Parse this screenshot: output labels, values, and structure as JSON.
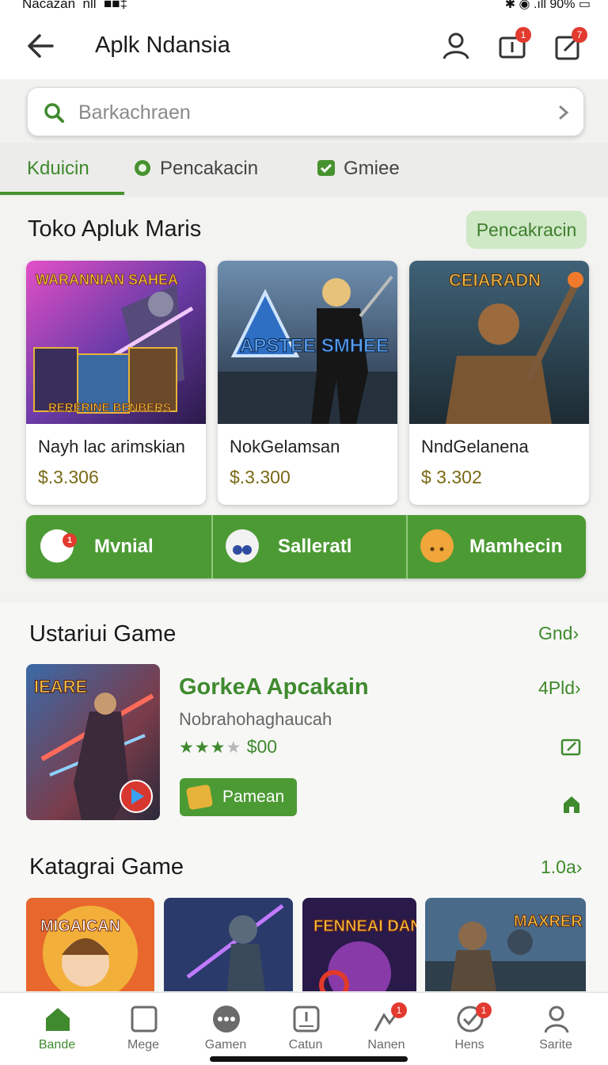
{
  "status_bar": {
    "left": "Nacazan  nll  ■■‡",
    "right": "✱ ◉ .ıll 90% ▭"
  },
  "header": {
    "title": "Aplk Ndansia",
    "notif_badge_1": "1",
    "notif_badge_2": "7"
  },
  "search": {
    "placeholder": "Barkachraen"
  },
  "tabs": [
    {
      "label": "Kduicin"
    },
    {
      "label": "Pencakacin"
    },
    {
      "label": "Gmiee"
    }
  ],
  "section_store": {
    "title": "Toko Apluk Maris",
    "button": "Pencakracin",
    "cards": [
      {
        "art_text": "WARANNIAN SAHEA",
        "art_sub": "RERERINE BENBERS",
        "name": "Nayh lac arimskian",
        "price": "$.3.306"
      },
      {
        "art_text": "APSTEE SMHEE",
        "name": "NokGelamsan",
        "price": "$.3.300"
      },
      {
        "art_text": "CEIARADN",
        "name": "NndGelanena",
        "price": "$ 3.302"
      }
    ],
    "actions": [
      {
        "label": "Mvnial",
        "badge": "1"
      },
      {
        "label": "Salleratl"
      },
      {
        "label": "Mamhecin"
      }
    ]
  },
  "section_games": {
    "title": "Ustariui Game",
    "more": "Gnd",
    "featured": {
      "art_text": "IEARE",
      "title": "GorkeA Apcakain",
      "subtitle": "Nobrahohaghaucah",
      "rating": 3,
      "price": "$00",
      "more": "4Pld",
      "button": "Pamean"
    }
  },
  "section_categories": {
    "title": "Katagrai Game",
    "more": "1.0a",
    "thumbs": [
      {
        "text": "MIGAICAN"
      },
      {
        "text": ""
      },
      {
        "text": "FENNEAI DANRERS"
      },
      {
        "text": "MAXRER"
      }
    ]
  },
  "bottom_nav": [
    {
      "label": "Bande",
      "icon": "home-icon",
      "active": true
    },
    {
      "label": "Mege",
      "icon": "square-icon"
    },
    {
      "label": "Gamen",
      "icon": "more-dots-icon"
    },
    {
      "label": "Catun",
      "icon": "clipboard-icon"
    },
    {
      "label": "Nanen",
      "icon": "profile-alert-icon",
      "badge": "1"
    },
    {
      "label": "Hens",
      "icon": "check-circle-icon",
      "badge": "1"
    },
    {
      "label": "Sarite",
      "icon": "person-icon"
    }
  ],
  "colors": {
    "accent": "#4c9a34",
    "accent_dark": "#3f8a2e",
    "price": "#7a6a16",
    "badge": "#e33a2f"
  }
}
